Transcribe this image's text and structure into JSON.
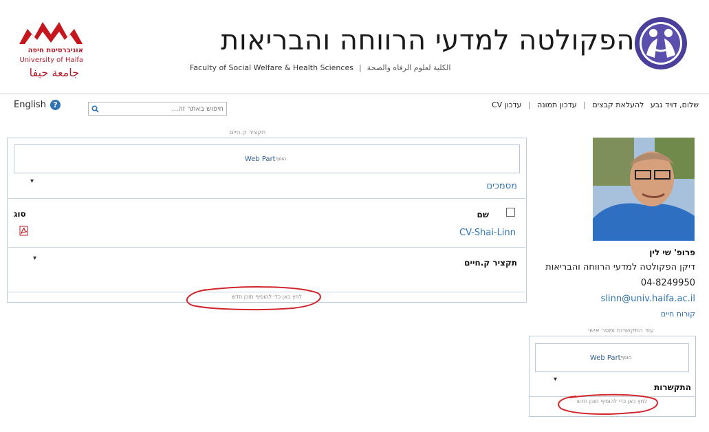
{
  "header": {
    "university_logo": {
      "name_he": "אוניברסיטת חיפה",
      "name_en": "University of Haifa",
      "name_ar": "جامعة حيفا",
      "color": "#b21f2d"
    },
    "faculty_title": "הפקולטה למדעי הרווחה והבריאות",
    "faculty_subtitle_en": "Faculty of Social Welfare & Health Sciences",
    "faculty_subtitle_sep": "|",
    "faculty_subtitle_ar": "الكلية لعلوم الرفاه والصحة"
  },
  "topbar": {
    "language_link": "English",
    "help_icon": "question-icon",
    "search_placeholder": "חיפוש באתר זה...",
    "search_icon": "search-icon",
    "user_links": [
      "שלום, דויד גבע",
      "להעלאת קבצים",
      "עדכון תמונה",
      "עדכון CV"
    ],
    "link_separator": "|"
  },
  "center": {
    "zone_title": "תקציר ק.חיים",
    "webpart_add_label": "Web Part",
    "webpart_add_hint": "הוסף",
    "documents_title": "מסמכים",
    "columns": {
      "type": "סוג",
      "name": "שם"
    },
    "files": [
      {
        "name": "CV-Shai-Linn",
        "type_icon": "pdf-icon"
      }
    ],
    "cv_summary_title": "תקציר ק.חיים",
    "add_new_item_hint": "לחץ כאן כדי להוסיף תוכן חדש"
  },
  "profile": {
    "name": "פרופ' שי לין",
    "role": "דיקן הפקולטה למדעי הרווחה והבריאות",
    "phone": "04-8249950",
    "email": "slinn@univ.haifa.ac.il",
    "cv_link": "קורות חיים",
    "contact_zone_title": "עוד התקשרות ומסר אישי",
    "webpart_add_label": "Web Part",
    "webpart_add_hint": "הוסף",
    "contact_title": "התקשרות",
    "add_new_item_hint": "לחץ כאן כדי להוסיף תוכן חדש"
  },
  "colors": {
    "link_blue": "#2f73b6",
    "annotation_red": "#d0262c",
    "zone_border": "#b8c9dc"
  }
}
